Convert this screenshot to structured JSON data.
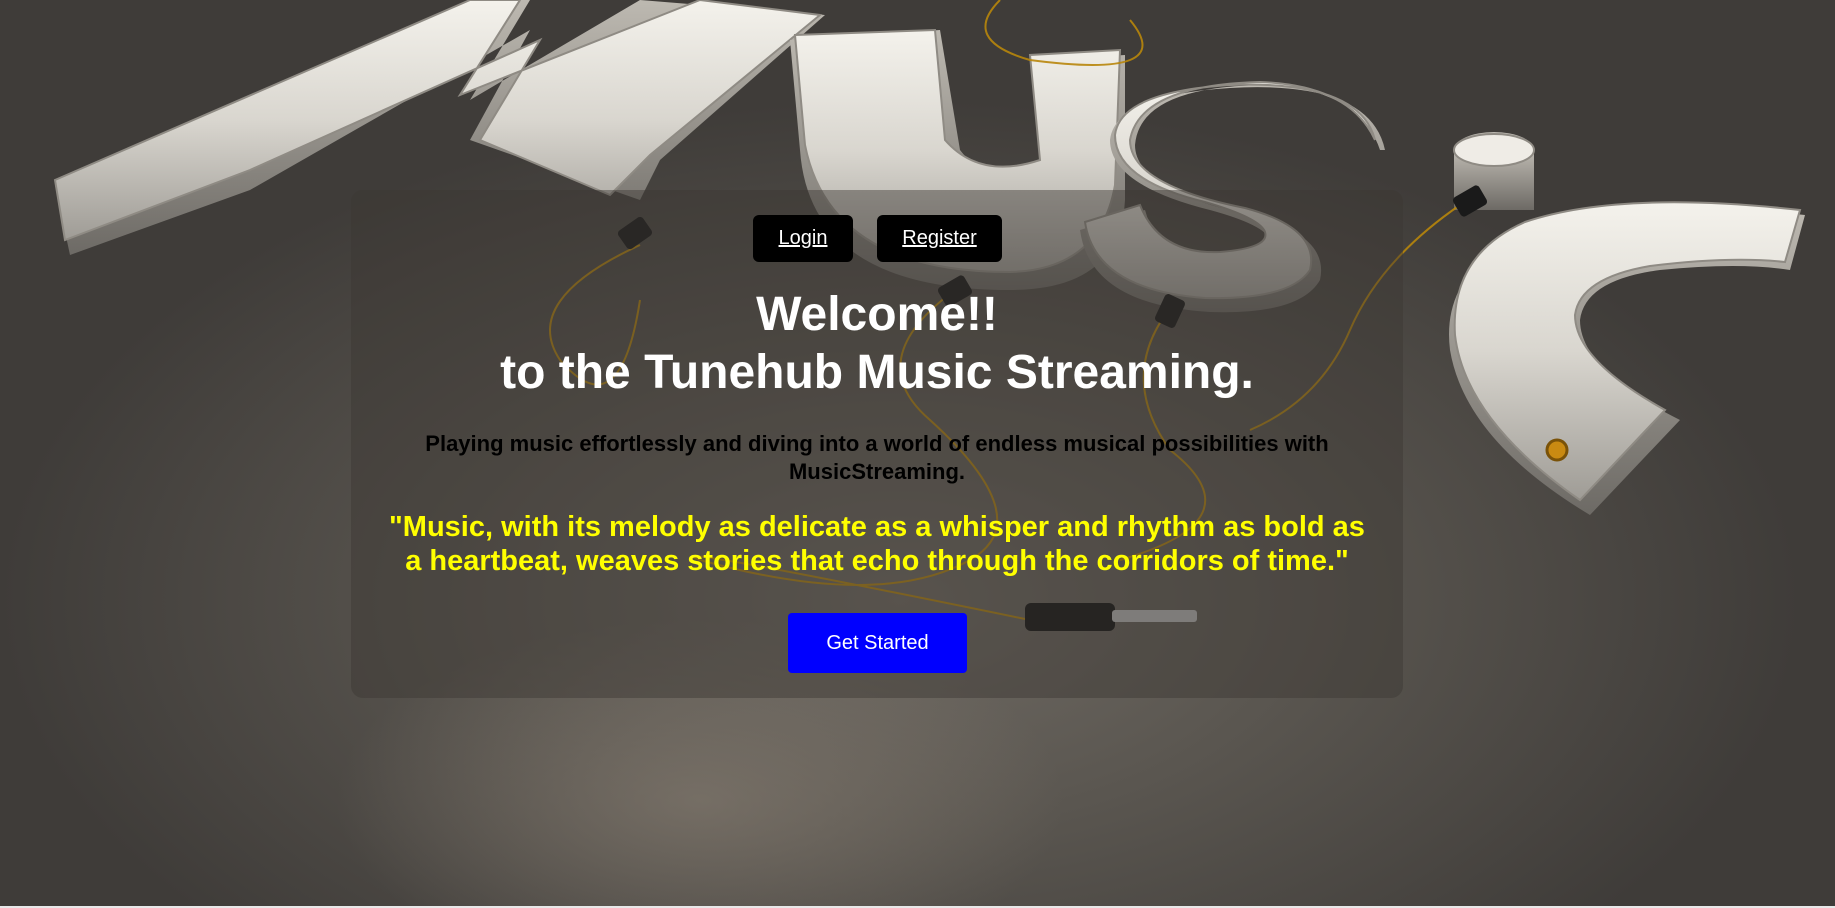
{
  "nav": {
    "login_label": "Login",
    "register_label": "Register"
  },
  "hero": {
    "welcome_line1": "Welcome!!",
    "welcome_line2": "to the Tunehub Music Streaming.",
    "tagline": "Playing music effortlessly and diving into a world of endless musical possibilities with MusicStreaming.",
    "quote": "\"Music, with its melody as delicate as a whisper and rhythm as bold as a heartbeat, weaves stories that echo through the corridors of time.\"",
    "cta_label": "Get Started"
  },
  "colors": {
    "cta_background": "#0000ff",
    "quote_text": "#ffff00",
    "auth_button_background": "#000000"
  }
}
